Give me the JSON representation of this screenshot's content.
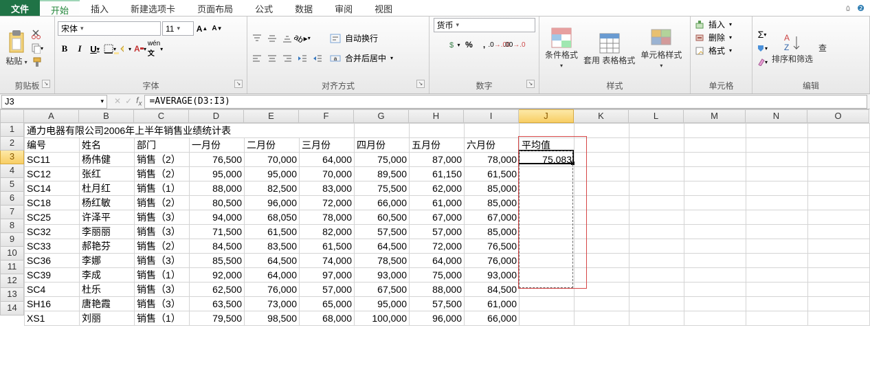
{
  "tabs": {
    "file": "文件",
    "home": "开始",
    "insert": "插入",
    "custom": "新建选项卡",
    "pagelayout": "页面布局",
    "formulas": "公式",
    "data": "数据",
    "review": "审阅",
    "view": "视图"
  },
  "ribbon": {
    "clipboard": {
      "paste": "粘贴",
      "label": "剪贴板"
    },
    "font": {
      "name": "宋体",
      "size": "11",
      "label": "字体",
      "bold": "B",
      "italic": "I",
      "underline": "U",
      "increase": "A",
      "decrease": "A"
    },
    "align": {
      "label": "对齐方式",
      "wrap": "自动换行",
      "merge": "合并后居中"
    },
    "number": {
      "label": "数字",
      "format": "货币"
    },
    "styles": {
      "cond": "条件格式",
      "table": "套用\n表格格式",
      "cell": "单元格样式",
      "label": "样式"
    },
    "cells": {
      "insert": "插入",
      "delete": "删除",
      "format": "格式",
      "label": "单元格"
    },
    "editing": {
      "label": "编辑",
      "autosum": "Σ",
      "sortfilter": "排序和筛选",
      "findselect": "查"
    }
  },
  "fbar": {
    "name": "J3",
    "formula": "=AVERAGE(D3:I3)"
  },
  "grid": {
    "columns": [
      "A",
      "B",
      "C",
      "D",
      "E",
      "F",
      "G",
      "H",
      "I",
      "J",
      "K",
      "L",
      "M",
      "N",
      "O"
    ],
    "widths": [
      80,
      80,
      80,
      80,
      80,
      80,
      80,
      80,
      80,
      80,
      80,
      80,
      90,
      90,
      90
    ],
    "activeCol": "J",
    "activeRow": 3,
    "title": "通力电器有限公司2006年上半年销售业绩统计表",
    "headers": [
      "编号",
      "姓名",
      "部门",
      "一月份",
      "二月份",
      "三月份",
      "四月份",
      "五月份",
      "六月份",
      "平均值"
    ],
    "rows": [
      [
        "SC11",
        "杨伟健",
        "销售（2）",
        "76,500",
        "70,000",
        "64,000",
        "75,000",
        "87,000",
        "78,000",
        "75,083"
      ],
      [
        "SC12",
        "张红",
        "销售（2）",
        "95,000",
        "95,000",
        "70,000",
        "89,500",
        "61,150",
        "61,500",
        ""
      ],
      [
        "SC14",
        "杜月红",
        "销售（1）",
        "88,000",
        "82,500",
        "83,000",
        "75,500",
        "62,000",
        "85,000",
        ""
      ],
      [
        "SC18",
        "杨红敏",
        "销售（2）",
        "80,500",
        "96,000",
        "72,000",
        "66,000",
        "61,000",
        "85,000",
        ""
      ],
      [
        "SC25",
        "许泽平",
        "销售（3）",
        "94,000",
        "68,050",
        "78,000",
        "60,500",
        "67,000",
        "67,000",
        ""
      ],
      [
        "SC32",
        "李丽丽",
        "销售（3）",
        "71,500",
        "61,500",
        "82,000",
        "57,500",
        "57,000",
        "85,000",
        ""
      ],
      [
        "SC33",
        "郝艳芬",
        "销售（2）",
        "84,500",
        "83,500",
        "61,500",
        "64,500",
        "72,000",
        "76,500",
        ""
      ],
      [
        "SC36",
        "李娜",
        "销售（3）",
        "85,500",
        "64,500",
        "74,000",
        "78,500",
        "64,000",
        "76,000",
        ""
      ],
      [
        "SC39",
        "李成",
        "销售（1）",
        "92,000",
        "64,000",
        "97,000",
        "93,000",
        "75,000",
        "93,000",
        ""
      ],
      [
        "SC4",
        "杜乐",
        "销售（3）",
        "62,500",
        "76,000",
        "57,000",
        "67,500",
        "88,000",
        "84,500",
        ""
      ],
      [
        "SH16",
        "唐艳霞",
        "销售（3）",
        "63,500",
        "73,000",
        "65,000",
        "95,000",
        "57,500",
        "61,000",
        ""
      ],
      [
        "XS1",
        "刘丽",
        "销售（1）",
        "79,500",
        "98,500",
        "68,000",
        "100,000",
        "96,000",
        "66,000",
        ""
      ]
    ]
  }
}
